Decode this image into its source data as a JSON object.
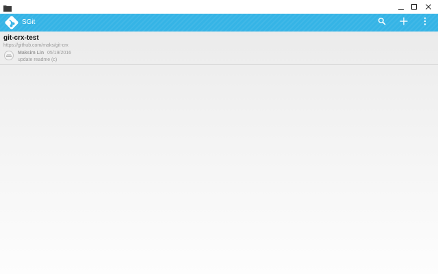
{
  "window": {
    "icons": {
      "app": "folder-icon",
      "minimize": "minimize-icon",
      "maximize": "maximize-icon",
      "close": "close-icon"
    }
  },
  "appbar": {
    "title": "SGit",
    "color": "#35b4e6",
    "icons": {
      "logo": "git-logo-icon",
      "search": "search-icon",
      "add": "plus-icon",
      "more": "more-vertical-icon"
    }
  },
  "repos": [
    {
      "name": "git-crx-test",
      "url": "https://github.com/maks/git-crx",
      "last_commit": {
        "author": "Maksim Lin",
        "date": "05/19/2016",
        "message": "update readme (c)"
      }
    }
  ]
}
